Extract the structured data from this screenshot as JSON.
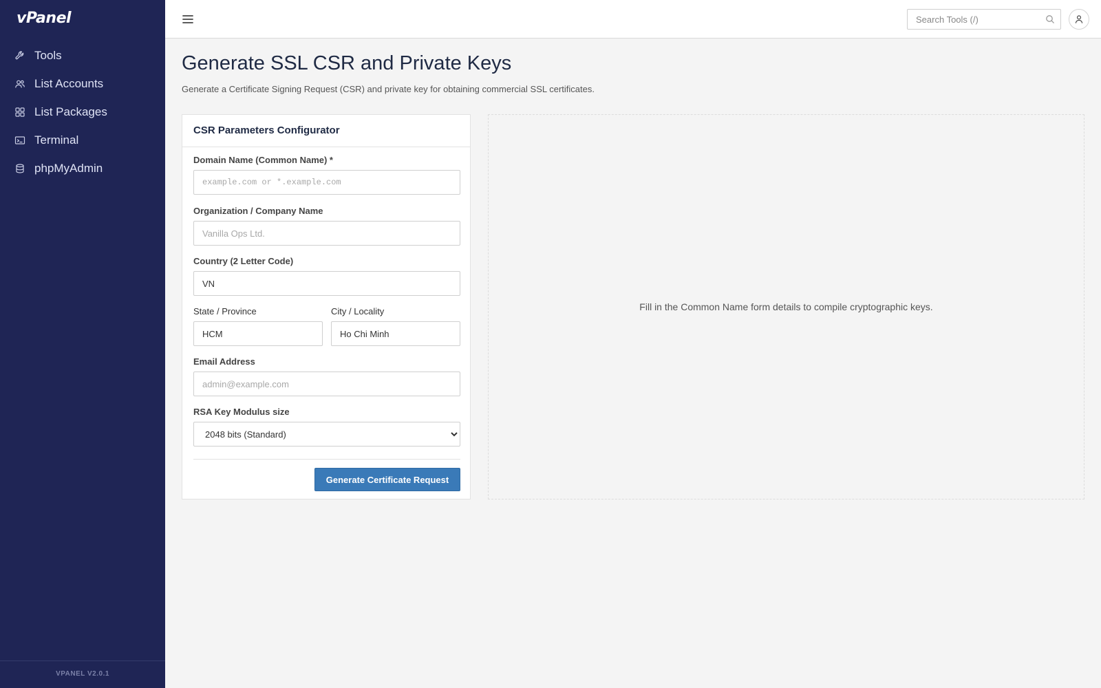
{
  "app": {
    "logo": "vPanel",
    "version": "VPANEL V2.0.1"
  },
  "sidebar": {
    "items": [
      {
        "label": "Tools",
        "icon": "wrench-icon"
      },
      {
        "label": "List Accounts",
        "icon": "users-icon"
      },
      {
        "label": "List Packages",
        "icon": "grid-icon"
      },
      {
        "label": "Terminal",
        "icon": "terminal-icon"
      },
      {
        "label": "phpMyAdmin",
        "icon": "database-icon"
      }
    ]
  },
  "topbar": {
    "search": {
      "placeholder": "Search Tools (/)",
      "value": ""
    }
  },
  "page": {
    "title": "Generate SSL CSR and Private Keys",
    "subtitle": "Generate a Certificate Signing Request (CSR) and private key for obtaining commercial SSL certificates."
  },
  "form": {
    "header": "CSR Parameters Configurator",
    "domain": {
      "label": "Domain Name (Common Name) *",
      "placeholder": "example.com or *.example.com",
      "value": ""
    },
    "organization": {
      "label": "Organization / Company Name",
      "placeholder": "Vanilla Ops Ltd.",
      "value": ""
    },
    "country": {
      "label": "Country (2 Letter Code)",
      "value": "VN"
    },
    "state": {
      "label": "State / Province",
      "value": "HCM"
    },
    "city": {
      "label": "City / Locality",
      "value": "Ho Chi Minh"
    },
    "email": {
      "label": "Email Address",
      "placeholder": "admin@example.com",
      "value": ""
    },
    "key_size": {
      "label": "RSA Key Modulus size",
      "selected": "2048 bits (Standard)"
    },
    "submit_label": "Generate Certificate Request"
  },
  "output": {
    "message": "Fill in the Common Name form details to compile cryptographic keys."
  },
  "colors": {
    "sidebar_bg": "#1f2555",
    "primary_button": "#3a7ab8",
    "page_bg": "#f4f4f4"
  }
}
